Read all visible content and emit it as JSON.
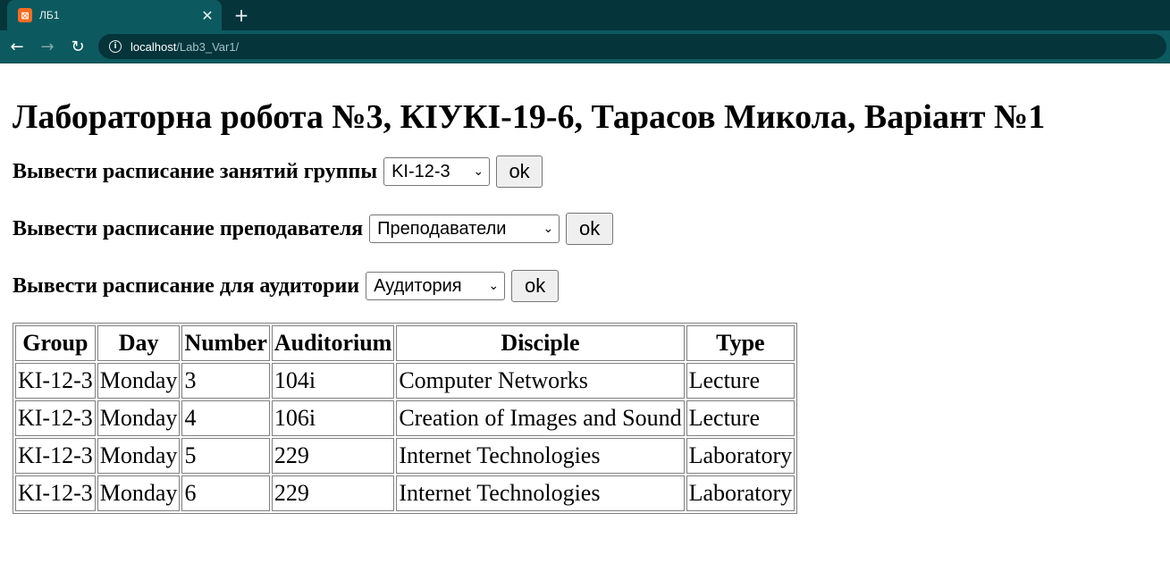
{
  "browser": {
    "tab_title": "ЛБ1",
    "favicon_glyph": "⊠",
    "url_host": "localhost",
    "url_path": "/Lab3_Var1/",
    "accent": "#0c5a60"
  },
  "page": {
    "heading": "Лабораторна робота №3, КІУКІ-19-6, Тарасов Микола, Варіант №1",
    "forms": [
      {
        "label": "Вывести расписание занятий группы",
        "selected": "KI-12-3",
        "button": "ok"
      },
      {
        "label": "Вывести расписание преподавателя",
        "selected": "Преподаватели",
        "button": "ok"
      },
      {
        "label": "Вывести расписание для аудитории",
        "selected": "Аудитория",
        "button": "ok"
      }
    ],
    "table": {
      "headers": [
        "Group",
        "Day",
        "Number",
        "Auditorium",
        "Disciple",
        "Type"
      ],
      "rows": [
        [
          "KI-12-3",
          "Monday",
          "3",
          "104i",
          "Computer Networks",
          "Lecture"
        ],
        [
          "KI-12-3",
          "Monday",
          "4",
          "106i",
          "Creation of Images and Sound",
          "Lecture"
        ],
        [
          "KI-12-3",
          "Monday",
          "5",
          "229",
          "Internet Technologies",
          "Laboratory"
        ],
        [
          "KI-12-3",
          "Monday",
          "6",
          "229",
          "Internet Technologies",
          "Laboratory"
        ]
      ]
    }
  }
}
